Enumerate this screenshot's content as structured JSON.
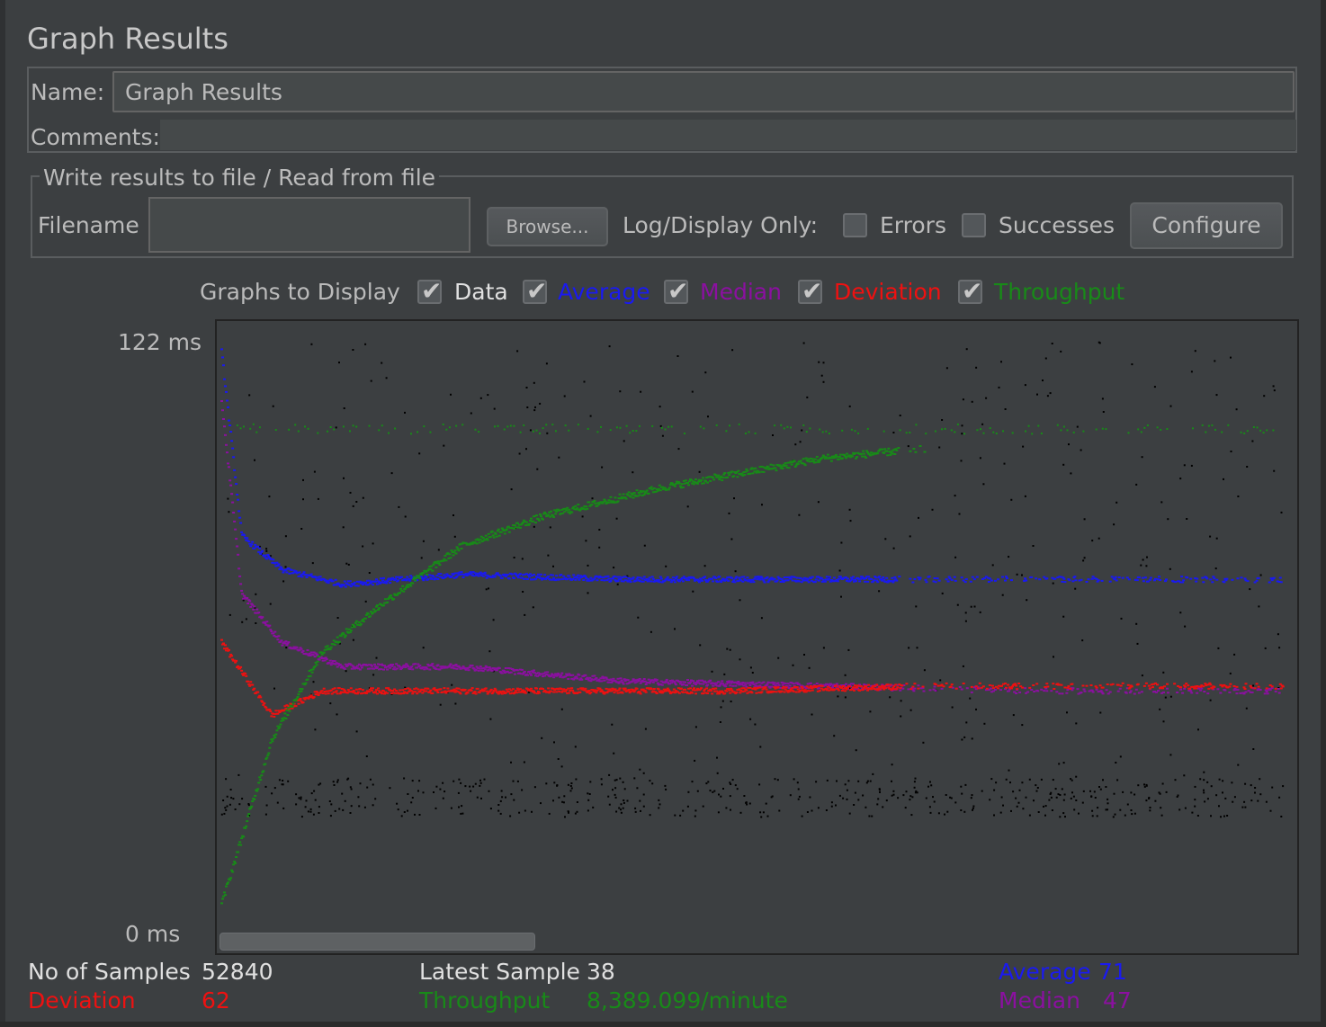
{
  "panel": {
    "title": "Graph Results",
    "name_label": "Name:",
    "name_value": "Graph Results",
    "comments_label": "Comments:",
    "comments_value": ""
  },
  "file_panel": {
    "legend": "Write results to file / Read from file",
    "filename_label": "Filename",
    "filename_value": "",
    "browse_label": "Browse...",
    "log_display_label": "Log/Display Only:",
    "errors_label": "Errors",
    "errors_checked": false,
    "successes_label": "Successes",
    "successes_checked": false,
    "configure_label": "Configure"
  },
  "graphs_to_display": {
    "label": "Graphs to Display",
    "options": [
      {
        "label": "Data",
        "checked": true,
        "color": "#000000"
      },
      {
        "label": "Average",
        "checked": true,
        "color": "#1a1af0"
      },
      {
        "label": "Median",
        "checked": true,
        "color": "#8b10a0"
      },
      {
        "label": "Deviation",
        "checked": true,
        "color": "#ee1111"
      },
      {
        "label": "Throughput",
        "checked": true,
        "color": "#188a18"
      }
    ]
  },
  "axis": {
    "y_max_label": "122  ms",
    "y_min_label": "0  ms"
  },
  "stats": {
    "samples_label": "No of Samples",
    "samples_value": "52840",
    "latest_label": "Latest Sample",
    "latest_value": "38",
    "average_label": "Average",
    "average_value": "71",
    "deviation_label": "Deviation",
    "deviation_value": "62",
    "throughput_label": "Throughput",
    "throughput_value": "8,389.099/minute",
    "median_label": "Median",
    "median_value": "47"
  },
  "colors": {
    "background": "#3c3f41",
    "data": "#000000",
    "average": "#1a1af0",
    "median": "#8b10a0",
    "deviation": "#ee1111",
    "throughput": "#188a18"
  },
  "chart_data": {
    "type": "scatter",
    "y_unit": "ms",
    "ylim": [
      0,
      122
    ],
    "xlim": [
      0,
      52840
    ],
    "series": [
      {
        "name": "Data",
        "color": "#000000",
        "points_note": "scatter of individual samples, mostly 25-40 ms and 70-122 ms"
      },
      {
        "name": "Average",
        "color": "#1a1af0",
        "points": [
          [
            0,
            120
          ],
          [
            1000,
            82
          ],
          [
            3000,
            75
          ],
          [
            6000,
            72
          ],
          [
            12000,
            74
          ],
          [
            20000,
            73
          ],
          [
            30000,
            73
          ],
          [
            40000,
            73
          ],
          [
            52840,
            73
          ]
        ]
      },
      {
        "name": "Median",
        "color": "#8b10a0",
        "points": [
          [
            0,
            110
          ],
          [
            1000,
            70
          ],
          [
            3000,
            60
          ],
          [
            6000,
            55
          ],
          [
            12000,
            55
          ],
          [
            20000,
            52
          ],
          [
            30000,
            51
          ],
          [
            40000,
            50
          ],
          [
            52840,
            50
          ]
        ]
      },
      {
        "name": "Deviation",
        "color": "#ee1111",
        "points": [
          [
            0,
            60
          ],
          [
            2500,
            45
          ],
          [
            5000,
            50
          ],
          [
            8000,
            50
          ],
          [
            15000,
            50
          ],
          [
            25000,
            50
          ],
          [
            35000,
            51
          ],
          [
            52840,
            51
          ]
        ]
      },
      {
        "name": "Throughput",
        "color": "#188a18",
        "points": [
          [
            0,
            6
          ],
          [
            2500,
            40
          ],
          [
            5000,
            58
          ],
          [
            8000,
            68
          ],
          [
            12000,
            80
          ],
          [
            16000,
            86
          ],
          [
            22000,
            92
          ],
          [
            30000,
            98
          ],
          [
            35000,
            100
          ]
        ]
      }
    ]
  }
}
